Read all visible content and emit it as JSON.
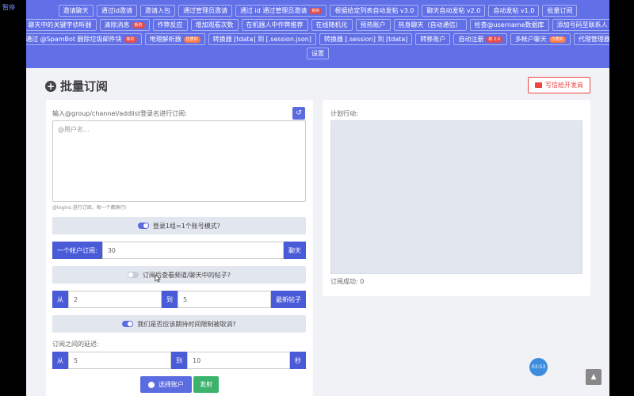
{
  "overlay": {
    "pause_label": "暂停"
  },
  "nav": {
    "row1": [
      {
        "label": "邀请聊天"
      },
      {
        "label": "通过id邀请"
      },
      {
        "label": "邀请入包"
      },
      {
        "label": "通过管理员邀请"
      },
      {
        "label": "通过 id 通过管理员邀请",
        "badge": "新的"
      },
      {
        "label": "根据给定列表自动发帖 v3.0"
      },
      {
        "label": "聊天自动发帖 v2.0"
      },
      {
        "label": "自动发帖 v1.0"
      },
      {
        "label": "批量订阅"
      }
    ],
    "row2": [
      {
        "label": "聊天中的关键字侦听器"
      },
      {
        "label": "清除消息",
        "badge": "新的"
      },
      {
        "label": "作弊反应"
      },
      {
        "label": "增加观看次数"
      },
      {
        "label": "在机器人中作弊推荐"
      },
      {
        "label": "在线随机化"
      },
      {
        "label": "预热账户"
      },
      {
        "label": "热身聊天（自动通信）"
      },
      {
        "label": "检查@username数据库"
      },
      {
        "label": "添加号码至联系人"
      }
    ],
    "row3": [
      {
        "label": "通过 @SpamBot 删除垃圾邮件块",
        "badge": "新的"
      },
      {
        "label": "地理解析器",
        "badge": "优质的",
        "badge_style": "orange"
      },
      {
        "label": "转换器 [tdata] 到 [.session.json]"
      },
      {
        "label": "转换器 [.session] 到 [tdata]"
      },
      {
        "label": "转移账户"
      },
      {
        "label": "自动注册",
        "badge": "新 2.0"
      },
      {
        "label": "多帐户聊天",
        "badge": "优质的",
        "badge_style": "orange"
      },
      {
        "label": "代理管理器"
      }
    ],
    "row4": [
      {
        "label": "设置"
      }
    ]
  },
  "header": {
    "title": "批量订阅",
    "email_button": "写信给开发商"
  },
  "left": {
    "input_label": "输入@group/channel/addlist登录名进行订阅:",
    "textarea_placeholder": "@用户名...",
    "hint": "@logins 进行订阅。每一个都换行!",
    "toggle1": "登录1组=1个账号模式?",
    "per_account_label": "一个帐户订阅:",
    "per_account_value": "30",
    "per_account_suffix": "聊天",
    "toggle2": "订阅后查看频道/聊天中的帖子?",
    "from_label": "从",
    "posts_from": "2",
    "to_label": "到",
    "posts_to": "5",
    "posts_suffix": "最新帖子",
    "toggle3": "我们是否应该期待时间限制被取消?",
    "delay_label": "订阅之间的延迟:",
    "delay_from_label": "从",
    "delay_from": "5",
    "delay_to_label": "到",
    "delay_to": "10",
    "delay_suffix": "秒",
    "select_accounts": "选择账户",
    "send": "发射"
  },
  "right": {
    "plan_label": "计划行动:",
    "success_label": "订阅成功: 0"
  },
  "clock": "03:53",
  "scroll_top": "▲"
}
